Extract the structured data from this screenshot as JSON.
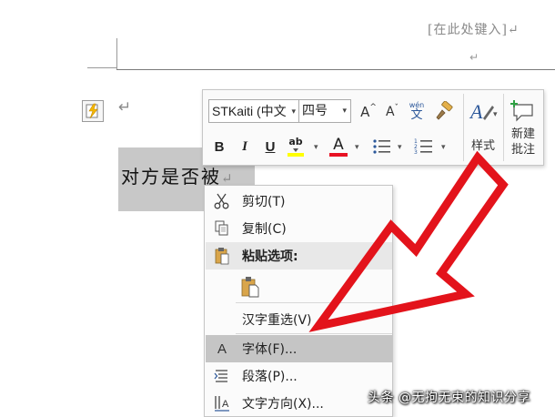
{
  "document": {
    "header_placeholder": "[在此处键入]↵",
    "header_paragraph_mark": "↵",
    "body_paragraph_mark": "↵",
    "selected_text": "对方是否被",
    "selected_text_mark": "↵"
  },
  "mini_toolbar": {
    "font_name": "STKaiti (中文",
    "font_size": "四号",
    "grow_font_glyph": "A",
    "shrink_font_glyph": "A",
    "phonetic_top": "wén",
    "phonetic_char": "文",
    "bold": "B",
    "italic": "I",
    "underline": "U",
    "highlight_glyph": "ab",
    "font_color_glyph": "A",
    "styles_label": "样式",
    "new_comment_label_line1": "新建",
    "new_comment_label_line2": "批注",
    "highlight_color": "#ffff00",
    "font_color": "#e81123",
    "accent_color": "#2b579a"
  },
  "context_menu": {
    "items": [
      {
        "label": "剪切(T)",
        "icon": "scissors-icon"
      },
      {
        "label": "复制(C)",
        "icon": "copy-icon"
      },
      {
        "label": "粘贴选项:",
        "icon": "clipboard-icon"
      },
      {
        "label": "汉字重选(V)",
        "icon": ""
      },
      {
        "label": "字体(F)...",
        "icon": "font-icon"
      },
      {
        "label": "段落(P)...",
        "icon": "paragraph-icon"
      },
      {
        "label": "文字方向(X)...",
        "icon": "text-direction-icon"
      }
    ],
    "font_icon_glyph": "A",
    "hover_item": "字体(F)..."
  },
  "overlay": {
    "arrow_color": "#e3131b"
  },
  "watermark": "头条 @无拘无束的知识分享"
}
